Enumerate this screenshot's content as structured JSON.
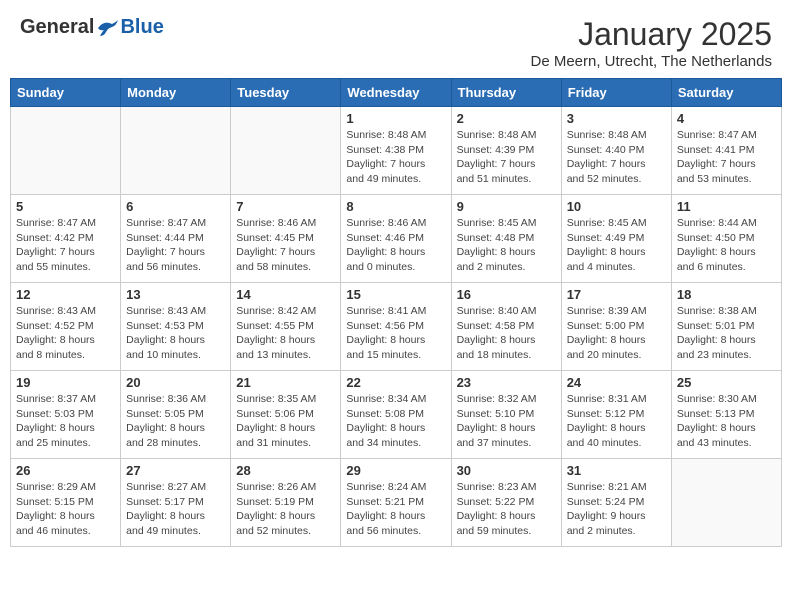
{
  "header": {
    "logo_general": "General",
    "logo_blue": "Blue",
    "month_title": "January 2025",
    "location": "De Meern, Utrecht, The Netherlands"
  },
  "weekdays": [
    "Sunday",
    "Monday",
    "Tuesday",
    "Wednesday",
    "Thursday",
    "Friday",
    "Saturday"
  ],
  "weeks": [
    [
      {
        "day": "",
        "info": ""
      },
      {
        "day": "",
        "info": ""
      },
      {
        "day": "",
        "info": ""
      },
      {
        "day": "1",
        "info": "Sunrise: 8:48 AM\nSunset: 4:38 PM\nDaylight: 7 hours\nand 49 minutes."
      },
      {
        "day": "2",
        "info": "Sunrise: 8:48 AM\nSunset: 4:39 PM\nDaylight: 7 hours\nand 51 minutes."
      },
      {
        "day": "3",
        "info": "Sunrise: 8:48 AM\nSunset: 4:40 PM\nDaylight: 7 hours\nand 52 minutes."
      },
      {
        "day": "4",
        "info": "Sunrise: 8:47 AM\nSunset: 4:41 PM\nDaylight: 7 hours\nand 53 minutes."
      }
    ],
    [
      {
        "day": "5",
        "info": "Sunrise: 8:47 AM\nSunset: 4:42 PM\nDaylight: 7 hours\nand 55 minutes."
      },
      {
        "day": "6",
        "info": "Sunrise: 8:47 AM\nSunset: 4:44 PM\nDaylight: 7 hours\nand 56 minutes."
      },
      {
        "day": "7",
        "info": "Sunrise: 8:46 AM\nSunset: 4:45 PM\nDaylight: 7 hours\nand 58 minutes."
      },
      {
        "day": "8",
        "info": "Sunrise: 8:46 AM\nSunset: 4:46 PM\nDaylight: 8 hours\nand 0 minutes."
      },
      {
        "day": "9",
        "info": "Sunrise: 8:45 AM\nSunset: 4:48 PM\nDaylight: 8 hours\nand 2 minutes."
      },
      {
        "day": "10",
        "info": "Sunrise: 8:45 AM\nSunset: 4:49 PM\nDaylight: 8 hours\nand 4 minutes."
      },
      {
        "day": "11",
        "info": "Sunrise: 8:44 AM\nSunset: 4:50 PM\nDaylight: 8 hours\nand 6 minutes."
      }
    ],
    [
      {
        "day": "12",
        "info": "Sunrise: 8:43 AM\nSunset: 4:52 PM\nDaylight: 8 hours\nand 8 minutes."
      },
      {
        "day": "13",
        "info": "Sunrise: 8:43 AM\nSunset: 4:53 PM\nDaylight: 8 hours\nand 10 minutes."
      },
      {
        "day": "14",
        "info": "Sunrise: 8:42 AM\nSunset: 4:55 PM\nDaylight: 8 hours\nand 13 minutes."
      },
      {
        "day": "15",
        "info": "Sunrise: 8:41 AM\nSunset: 4:56 PM\nDaylight: 8 hours\nand 15 minutes."
      },
      {
        "day": "16",
        "info": "Sunrise: 8:40 AM\nSunset: 4:58 PM\nDaylight: 8 hours\nand 18 minutes."
      },
      {
        "day": "17",
        "info": "Sunrise: 8:39 AM\nSunset: 5:00 PM\nDaylight: 8 hours\nand 20 minutes."
      },
      {
        "day": "18",
        "info": "Sunrise: 8:38 AM\nSunset: 5:01 PM\nDaylight: 8 hours\nand 23 minutes."
      }
    ],
    [
      {
        "day": "19",
        "info": "Sunrise: 8:37 AM\nSunset: 5:03 PM\nDaylight: 8 hours\nand 25 minutes."
      },
      {
        "day": "20",
        "info": "Sunrise: 8:36 AM\nSunset: 5:05 PM\nDaylight: 8 hours\nand 28 minutes."
      },
      {
        "day": "21",
        "info": "Sunrise: 8:35 AM\nSunset: 5:06 PM\nDaylight: 8 hours\nand 31 minutes."
      },
      {
        "day": "22",
        "info": "Sunrise: 8:34 AM\nSunset: 5:08 PM\nDaylight: 8 hours\nand 34 minutes."
      },
      {
        "day": "23",
        "info": "Sunrise: 8:32 AM\nSunset: 5:10 PM\nDaylight: 8 hours\nand 37 minutes."
      },
      {
        "day": "24",
        "info": "Sunrise: 8:31 AM\nSunset: 5:12 PM\nDaylight: 8 hours\nand 40 minutes."
      },
      {
        "day": "25",
        "info": "Sunrise: 8:30 AM\nSunset: 5:13 PM\nDaylight: 8 hours\nand 43 minutes."
      }
    ],
    [
      {
        "day": "26",
        "info": "Sunrise: 8:29 AM\nSunset: 5:15 PM\nDaylight: 8 hours\nand 46 minutes."
      },
      {
        "day": "27",
        "info": "Sunrise: 8:27 AM\nSunset: 5:17 PM\nDaylight: 8 hours\nand 49 minutes."
      },
      {
        "day": "28",
        "info": "Sunrise: 8:26 AM\nSunset: 5:19 PM\nDaylight: 8 hours\nand 52 minutes."
      },
      {
        "day": "29",
        "info": "Sunrise: 8:24 AM\nSunset: 5:21 PM\nDaylight: 8 hours\nand 56 minutes."
      },
      {
        "day": "30",
        "info": "Sunrise: 8:23 AM\nSunset: 5:22 PM\nDaylight: 8 hours\nand 59 minutes."
      },
      {
        "day": "31",
        "info": "Sunrise: 8:21 AM\nSunset: 5:24 PM\nDaylight: 9 hours\nand 2 minutes."
      },
      {
        "day": "",
        "info": ""
      }
    ]
  ]
}
